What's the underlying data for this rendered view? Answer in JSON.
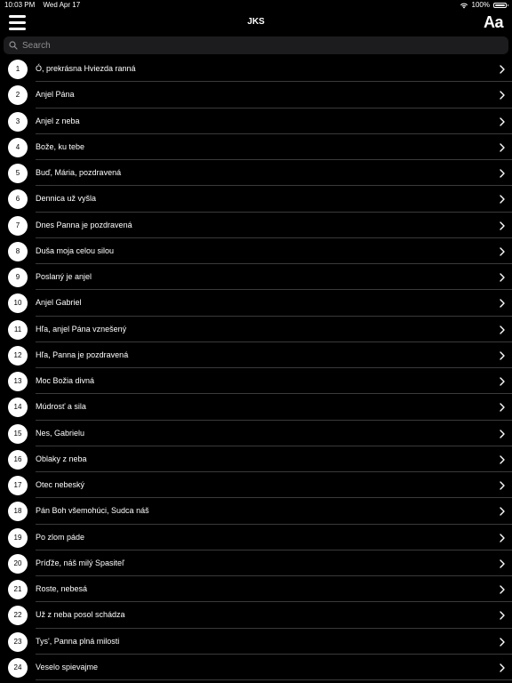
{
  "status_bar": {
    "time": "10:03 PM",
    "date": "Wed Apr 17",
    "battery": "100%"
  },
  "nav": {
    "title": "JKS",
    "font_button_label": "Aa"
  },
  "search": {
    "placeholder": "Search"
  },
  "songs": [
    {
      "number": "1",
      "title": "Ó, prekrásna Hviezda ranná"
    },
    {
      "number": "2",
      "title": "Anjel Pána"
    },
    {
      "number": "3",
      "title": "Anjel z neba"
    },
    {
      "number": "4",
      "title": "Bože, ku tebe"
    },
    {
      "number": "5",
      "title": "Buď, Mária, pozdravená"
    },
    {
      "number": "6",
      "title": "Dennica už vyšla"
    },
    {
      "number": "7",
      "title": "Dnes Panna je pozdravená"
    },
    {
      "number": "8",
      "title": "Duša moja celou silou"
    },
    {
      "number": "9",
      "title": "Poslaný je anjel"
    },
    {
      "number": "10",
      "title": "Anjel Gabriel"
    },
    {
      "number": "11",
      "title": "Hľa, anjel Pána vznešený"
    },
    {
      "number": "12",
      "title": "Hľa, Panna je pozdravená"
    },
    {
      "number": "13",
      "title": "Moc Božia divná"
    },
    {
      "number": "14",
      "title": "Múdrosť a sila"
    },
    {
      "number": "15",
      "title": "Nes, Gabrielu"
    },
    {
      "number": "16",
      "title": "Oblaky z neba"
    },
    {
      "number": "17",
      "title": "Otec nebeský"
    },
    {
      "number": "18",
      "title": "Pán Boh všemohúci, Sudca náš"
    },
    {
      "number": "19",
      "title": "Po zlom páde"
    },
    {
      "number": "20",
      "title": "Príďže, náš milý Spasiteľ"
    },
    {
      "number": "21",
      "title": "Roste, nebesá"
    },
    {
      "number": "22",
      "title": "Už z neba posol schádza"
    },
    {
      "number": "23",
      "title": "Tys', Panna plná milosti"
    },
    {
      "number": "24",
      "title": "Veselo spievajme"
    }
  ]
}
